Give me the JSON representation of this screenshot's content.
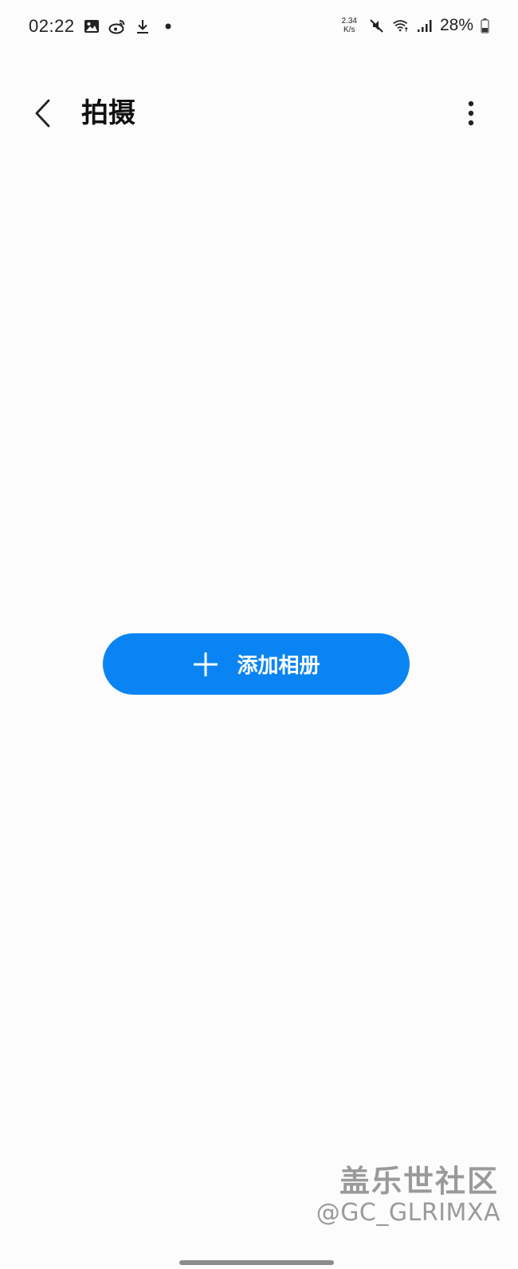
{
  "status_bar": {
    "time": "02:22",
    "left_icons": [
      "gallery-icon",
      "weibo-icon",
      "download-icon",
      "notification-dot-icon"
    ],
    "net_speed_value": "2.34",
    "net_speed_unit": "K/s",
    "right_icons": [
      "mute-icon",
      "wifi-icon",
      "signal-icon",
      "battery-icon"
    ],
    "battery_percent": "28%"
  },
  "app_bar": {
    "title": "拍摄",
    "back_icon": "chevron-left-icon",
    "more_icon": "more-vertical-icon"
  },
  "main": {
    "add_album_label": "添加相册",
    "add_icon": "plus-icon",
    "accent_color": "#0a84f2"
  },
  "watermark": {
    "logo_text": "盖乐世社区",
    "handle": "@GC_GLRIMXA"
  }
}
